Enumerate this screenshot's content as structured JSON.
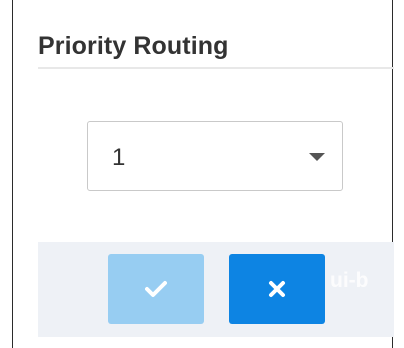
{
  "dialog": {
    "title": "Priority Routing"
  },
  "priority_select": {
    "value": "1"
  },
  "footer": {
    "watermark": "ui-b",
    "ok_icon": "check-icon",
    "cancel_icon": "close-icon"
  },
  "colors": {
    "ok_button": "#97cdf2",
    "cancel_button": "#0d84e3",
    "footer_background": "#eef1f6"
  }
}
